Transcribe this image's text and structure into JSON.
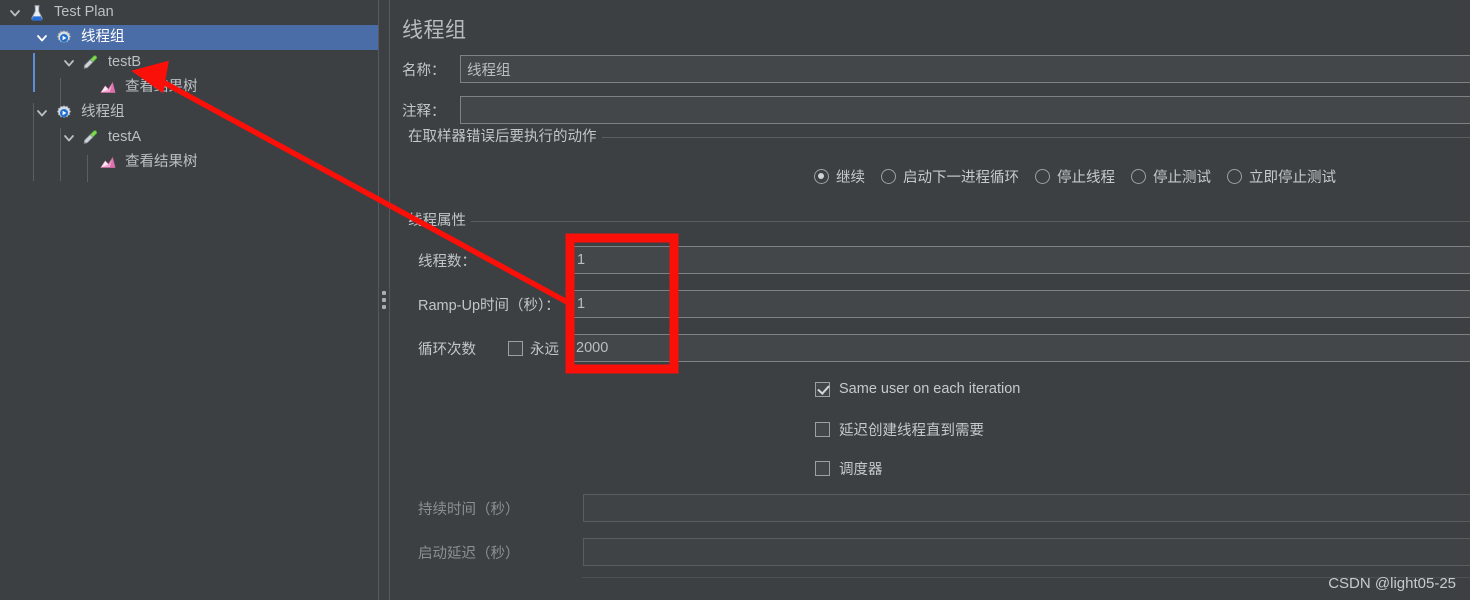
{
  "tree": {
    "nodes": [
      {
        "label": "Test Plan",
        "icon": "test-plan-icon",
        "depth": 0,
        "expanded": true,
        "selected": false
      },
      {
        "label": "线程组",
        "icon": "thread-group-icon",
        "depth": 1,
        "expanded": true,
        "selected": true
      },
      {
        "label": "testB",
        "icon": "sampler-icon",
        "depth": 2,
        "expanded": true,
        "selected": false
      },
      {
        "label": "查看结果树",
        "icon": "view-results-tree-icon",
        "depth": 3,
        "expanded": false,
        "selected": false
      },
      {
        "label": "线程组",
        "icon": "thread-group-icon",
        "depth": 1,
        "expanded": true,
        "selected": false
      },
      {
        "label": "testA",
        "icon": "sampler-icon",
        "depth": 2,
        "expanded": true,
        "selected": false
      },
      {
        "label": "查看结果树",
        "icon": "view-results-tree-icon",
        "depth": 3,
        "expanded": false,
        "selected": false
      }
    ]
  },
  "panel": {
    "title": "线程组",
    "name_label": "名称：",
    "name_value": "线程组",
    "comment_label": "注释：",
    "comment_value": "",
    "on_error_group_label": "在取样器错误后要执行的动作",
    "on_error_options": [
      {
        "label": "继续",
        "selected": true
      },
      {
        "label": "启动下一进程循环",
        "selected": false
      },
      {
        "label": "停止线程",
        "selected": false
      },
      {
        "label": "停止测试",
        "selected": false
      },
      {
        "label": "立即停止测试",
        "selected": false
      }
    ],
    "thread_props_group_label": "线程属性",
    "thread_count_label": "线程数：",
    "thread_count_value": "1",
    "ramp_up_label": "Ramp-Up时间（秒）：",
    "ramp_up_value": "1",
    "loop_count_label": "循环次数",
    "forever_label": "永远",
    "forever_checked": false,
    "loop_count_value": "2000",
    "same_user_label": "Same user on each iteration",
    "same_user_checked": true,
    "delay_thread_label": "延迟创建线程直到需要",
    "delay_thread_checked": false,
    "scheduler_label": "调度器",
    "scheduler_checked": false,
    "duration_label": "持续时间（秒）",
    "duration_value": "",
    "startup_delay_label": "启动延迟（秒）",
    "startup_delay_value": ""
  },
  "annotation": {
    "highlight_color": "#fa0f09",
    "arrow_color": "#fa0f09"
  },
  "watermark": {
    "text": "CSDN @light05-25"
  },
  "colors": {
    "background": "#3c4043",
    "selection": "#4a6da7",
    "text": "#c2c6ca",
    "border": "#7d8287"
  }
}
